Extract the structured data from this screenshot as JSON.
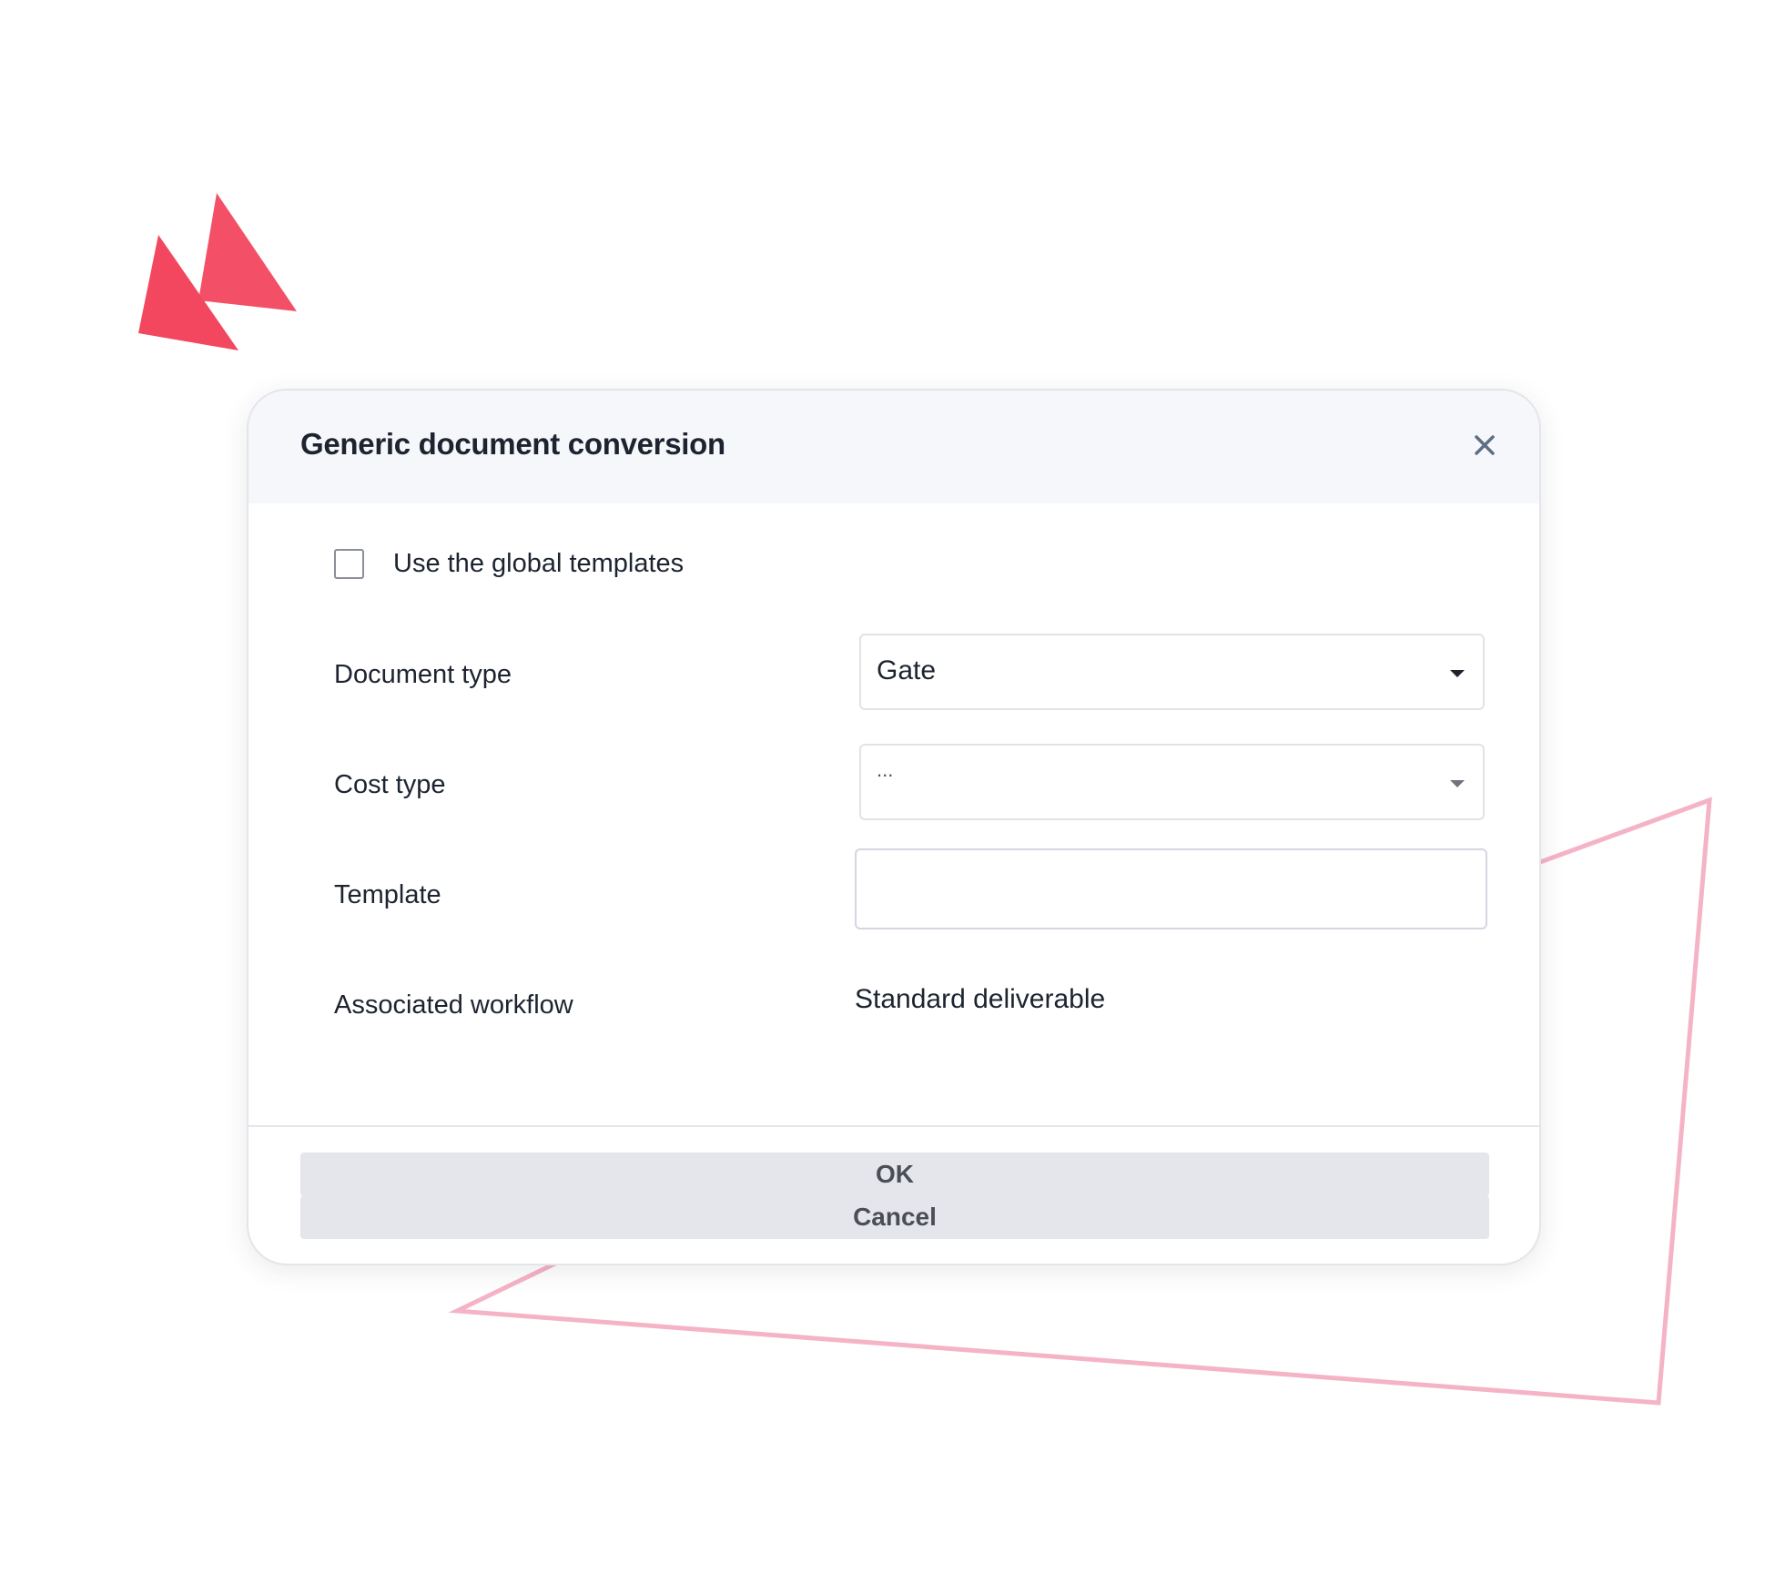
{
  "dialog": {
    "title": "Generic document conversion",
    "close_icon": "close-icon"
  },
  "form": {
    "checkbox": {
      "label": "Use the global templates",
      "checked": false
    },
    "document_type": {
      "label": "Document type",
      "value": "Gate"
    },
    "cost_type": {
      "label": "Cost type",
      "value": "..."
    },
    "template": {
      "label": "Template",
      "value": ""
    },
    "associated_workflow": {
      "label": "Associated workflow",
      "value": "Standard deliverable"
    }
  },
  "footer": {
    "ok_label": "OK",
    "cancel_label": "Cancel"
  },
  "colors": {
    "accent_triangles": "#f2475f",
    "outline_shape": "#f5b3c6",
    "header_bg": "#f6f7fb",
    "button_bg": "#e5e6eb"
  }
}
